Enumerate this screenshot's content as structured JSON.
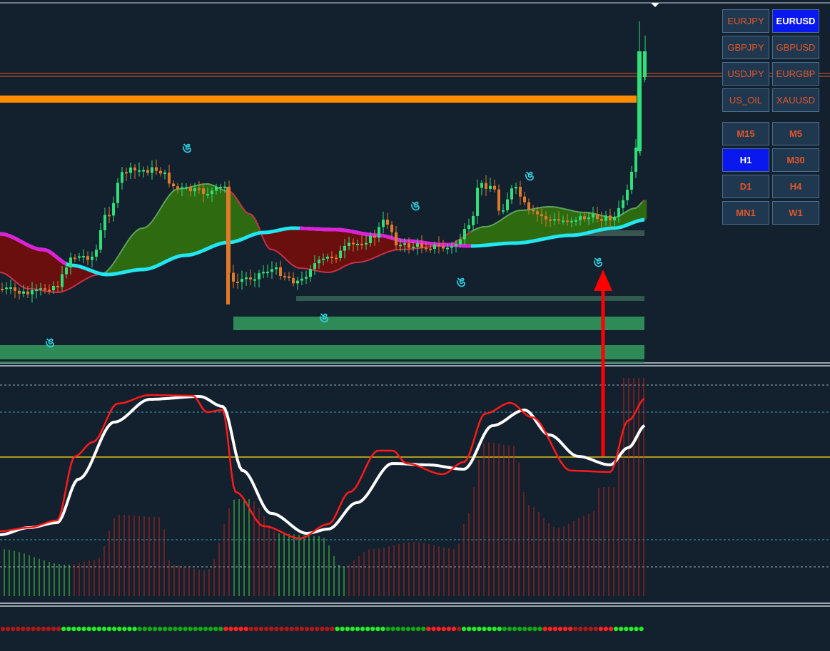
{
  "symbols": [
    {
      "label": "EURJPY",
      "selected": false
    },
    {
      "label": "EURUSD",
      "selected": true
    },
    {
      "label": "GBPJPY",
      "selected": false
    },
    {
      "label": "GBPUSD",
      "selected": false
    },
    {
      "label": "USDJPY",
      "selected": false
    },
    {
      "label": "EURGBP",
      "selected": false
    },
    {
      "label": "US_OIL",
      "selected": false
    },
    {
      "label": "XAUUSD",
      "selected": false
    }
  ],
  "timeframes": [
    {
      "label": "M15",
      "selected": false
    },
    {
      "label": "M5",
      "selected": false
    },
    {
      "label": "H1",
      "selected": true
    },
    {
      "label": "M30",
      "selected": false
    },
    {
      "label": "D1",
      "selected": false
    },
    {
      "label": "H4",
      "selected": false
    },
    {
      "label": "MN1",
      "selected": false
    },
    {
      "label": "W1",
      "selected": false
    }
  ],
  "signal_glyph": "ঙ",
  "colors": {
    "background": "#13202d",
    "bull_candle": "#2fe07a",
    "bear_candle": "#e07a2a",
    "fast_line": "#d8304a",
    "slow_line_up": "#22e6f0",
    "slow_line_down": "#e020d8",
    "zone": "#2e8b57",
    "resistance": "#ff8c00",
    "arrow": "#ff0000",
    "osc_white": "#ffffff",
    "osc_red": "#ff1a1a",
    "midline": "#e6c31a"
  }
}
